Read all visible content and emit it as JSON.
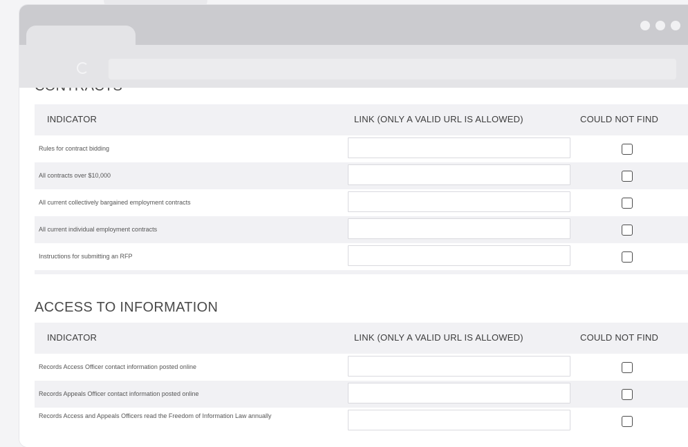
{
  "sections": [
    {
      "title": "CONTRACTS",
      "headers": {
        "indicator": "INDICATOR",
        "link": "LINK (ONLY A VALID URL IS ALLOWED)",
        "could_not_find": "COULD NOT FIND"
      },
      "rows": [
        {
          "label": "Rules for contract bidding",
          "url": "",
          "could_not_find": false
        },
        {
          "label": "All contracts over $10,000",
          "url": "",
          "could_not_find": false
        },
        {
          "label": "All current collectively bargained employment contracts",
          "url": "",
          "could_not_find": false
        },
        {
          "label": "All current individual employment contracts",
          "url": "",
          "could_not_find": false
        },
        {
          "label": "Instructions for submitting an RFP",
          "url": "",
          "could_not_find": false
        }
      ]
    },
    {
      "title": "ACCESS TO INFORMATION",
      "headers": {
        "indicator": "INDICATOR",
        "link": "LINK (ONLY A VALID URL IS ALLOWED)",
        "could_not_find": "COULD NOT FIND"
      },
      "rows": [
        {
          "label": "Records Access Officer contact information posted online",
          "url": "",
          "could_not_find": false
        },
        {
          "label": "Records Appeals Officer contact information posted online",
          "url": "",
          "could_not_find": false
        },
        {
          "label": "Records Access and Appeals Officers read the Freedom of Information Law annually",
          "url": "",
          "could_not_find": false
        }
      ]
    }
  ]
}
